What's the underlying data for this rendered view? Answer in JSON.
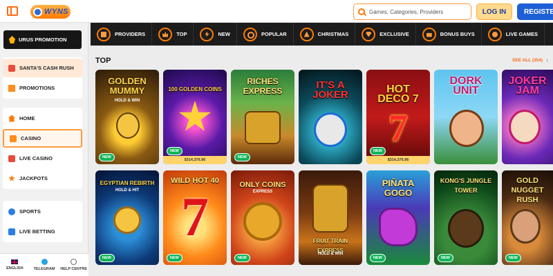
{
  "header": {
    "logo_text": "WYNS",
    "search_placeholder": "Games, Categories, Providers",
    "login_label": "LOG IN",
    "register_label": "REGISTER"
  },
  "sidebar": {
    "promo_banner": "URUS PROMOTION",
    "group1": [
      {
        "label": "SANTA'S CASH RUSH",
        "icon": "gift-icon"
      },
      {
        "label": "PROMOTIONS",
        "icon": "gift-icon"
      }
    ],
    "group2": [
      {
        "label": "HOME",
        "icon": "home-icon"
      },
      {
        "label": "CASINO",
        "icon": "slot-icon",
        "active": true
      },
      {
        "label": "LIVE CASINO",
        "icon": "cards-icon"
      },
      {
        "label": "JACKPOTS",
        "icon": "star-icon"
      }
    ],
    "group3": [
      {
        "label": "SPORTS",
        "icon": "ball-icon"
      },
      {
        "label": "LIVE BETTING",
        "icon": "live-icon"
      }
    ],
    "footer": {
      "english": "ENGLISH",
      "telegram": "TELEGRAM",
      "help": "HELP CENTRE"
    }
  },
  "categories": [
    {
      "label": "PROVIDERS",
      "icon": "providers-icon"
    },
    {
      "label": "TOP",
      "icon": "crown-icon"
    },
    {
      "label": "NEW",
      "icon": "lightning-icon"
    },
    {
      "label": "POPULAR",
      "icon": "fire-icon"
    },
    {
      "label": "CHRISTMAS",
      "icon": "tree-icon"
    },
    {
      "label": "EXCLUSIVE",
      "icon": "diamond-icon"
    },
    {
      "label": "BONUS BUYS",
      "icon": "bonus-icon"
    },
    {
      "label": "LIVE GAMES",
      "icon": "live-icon"
    }
  ],
  "section": {
    "title": "TOP",
    "see_all": "SEE ALL (354)",
    "arrow": "‹"
  },
  "games_row1": [
    {
      "title": "GOLDEN MUMMY",
      "subtitle": "HOLD & WIN",
      "new": "NEW",
      "jackpot": ""
    },
    {
      "title": "100 GOLDEN COINS",
      "subtitle": "",
      "new": "NEW",
      "jackpot": "$314,376.96"
    },
    {
      "title": "RICHES EXPRESS",
      "subtitle": "",
      "new": "NEW",
      "jackpot": ""
    },
    {
      "title": "IT'S A JOKER",
      "subtitle": "",
      "new": "",
      "jackpot": ""
    },
    {
      "title": "HOT DECO 7",
      "subtitle": "",
      "new": "NEW",
      "jackpot": "$314,376.96"
    },
    {
      "title": "DORK UNIT",
      "subtitle": "",
      "new": "",
      "jackpot": ""
    },
    {
      "title": "JOKER JAM",
      "subtitle": "",
      "new": "",
      "jackpot": ""
    }
  ],
  "games_row2": [
    {
      "title": "EGYPTIAN REBIRTH",
      "subtitle": "HOLD & HIT",
      "new": "NEW"
    },
    {
      "title": "WILD HOT 40",
      "subtitle": "",
      "new": "NEW"
    },
    {
      "title": "ONLY COINS",
      "subtitle": "EXPRESS",
      "new": "NEW"
    },
    {
      "title": "FRUIT TRAIN EXPRESS",
      "subtitle": "HOLD & WIN",
      "new": ""
    },
    {
      "title": "PIÑATA GOGO",
      "subtitle": "",
      "new": "NEW"
    },
    {
      "title": "KONG'S JUNGLE TOWER",
      "subtitle": "",
      "new": "NEW"
    },
    {
      "title": "GOLD NUGGET RUSH",
      "subtitle": "",
      "new": "NEW"
    }
  ]
}
